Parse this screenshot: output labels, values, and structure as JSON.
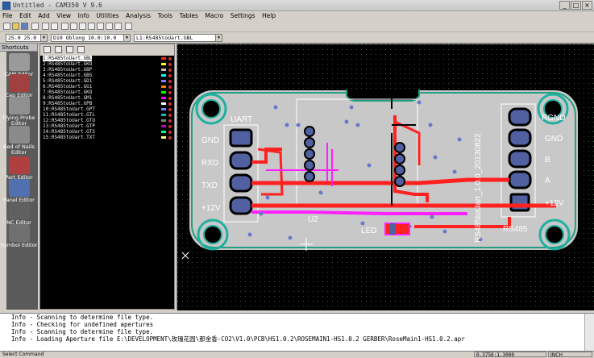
{
  "window": {
    "title": "Untitled - CAM350 V 9.6",
    "controls": [
      "_",
      "□",
      "×"
    ]
  },
  "menu": [
    "File",
    "Edit",
    "Add",
    "View",
    "Info",
    "Utilities",
    "Analysis",
    "Tools",
    "Tables",
    "Macro",
    "Settings",
    "Help"
  ],
  "combos": {
    "grid": "25.0 25.0",
    "dcode": "D10  Oblong 10.0:10.0",
    "layer": "L1:RS485toUart.GBL"
  },
  "shortcuts": {
    "header": "Shortcuts",
    "items": [
      "CAM Editor",
      "Cap Editor",
      "Flying Probe Editor",
      "Bed of Nails Editor",
      "Part Editor",
      "Panel Editor",
      "NC Editor",
      "Symbol Editor"
    ]
  },
  "layers": [
    {
      "label": "1:RS485toUart.GBL",
      "color": "#ff2020",
      "selected": true
    },
    {
      "label": "2:RS485toUart.GKO",
      "color": "#ffff00"
    },
    {
      "label": "3:RS485toUart.GBP",
      "color": "#c0c0c0"
    },
    {
      "label": "4:RS485toUart.GBS",
      "color": "#00ffff"
    },
    {
      "label": "5:RS485toUart.GD1",
      "color": "#8080ff"
    },
    {
      "label": "6:RS485toUart.GG1",
      "color": "#ff8000"
    },
    {
      "label": "7:RS485toUart.GKO",
      "color": "#00ff00"
    },
    {
      "label": "8:RS485toUart.GM1",
      "color": "#ff00ff"
    },
    {
      "label": "9:RS485toUart.GPB",
      "color": "#ffffff"
    },
    {
      "label": "10:RS485toUart.GPT",
      "color": "#8080ff"
    },
    {
      "label": "11:RS485toUart.GTL",
      "color": "#00c0c0"
    },
    {
      "label": "12:RS485toUart.GTO",
      "color": "#808080"
    },
    {
      "label": "13:RS485toUart.GTP",
      "color": "#c000c0"
    },
    {
      "label": "14:RS485toUart.GTS",
      "color": "#00ff80"
    },
    {
      "label": "15:RS485toUart.TXT",
      "color": "#ffff80"
    }
  ],
  "board": {
    "left_labels": [
      "UART",
      "GND",
      "RXD",
      "TXD",
      "+12V"
    ],
    "right_labels": [
      "RGND",
      "GND",
      "B",
      "A",
      "+12V",
      "RS485"
    ],
    "u2": "U2",
    "led": "LED",
    "vertical_text": "RS485toUart_1.0.0_20130822"
  },
  "log": [
    "Info - Scanning to determine file type.",
    "Info - Checking for undefined apertures",
    "Info - Scanning to determine file type.",
    "Info - Loading Aperture file E:\\DEVELOPMENT\\玫瑰花园\\那金香-CO2\\V1.0\\PCB\\HS1.0.2\\ROSEMAIN1-HS1.0.2 GERBER\\RoseMain1-HS1.0.2.apr"
  ],
  "status": {
    "left": "Select Command",
    "coord": "0.3750:1.3000",
    "unit": "INCH"
  }
}
